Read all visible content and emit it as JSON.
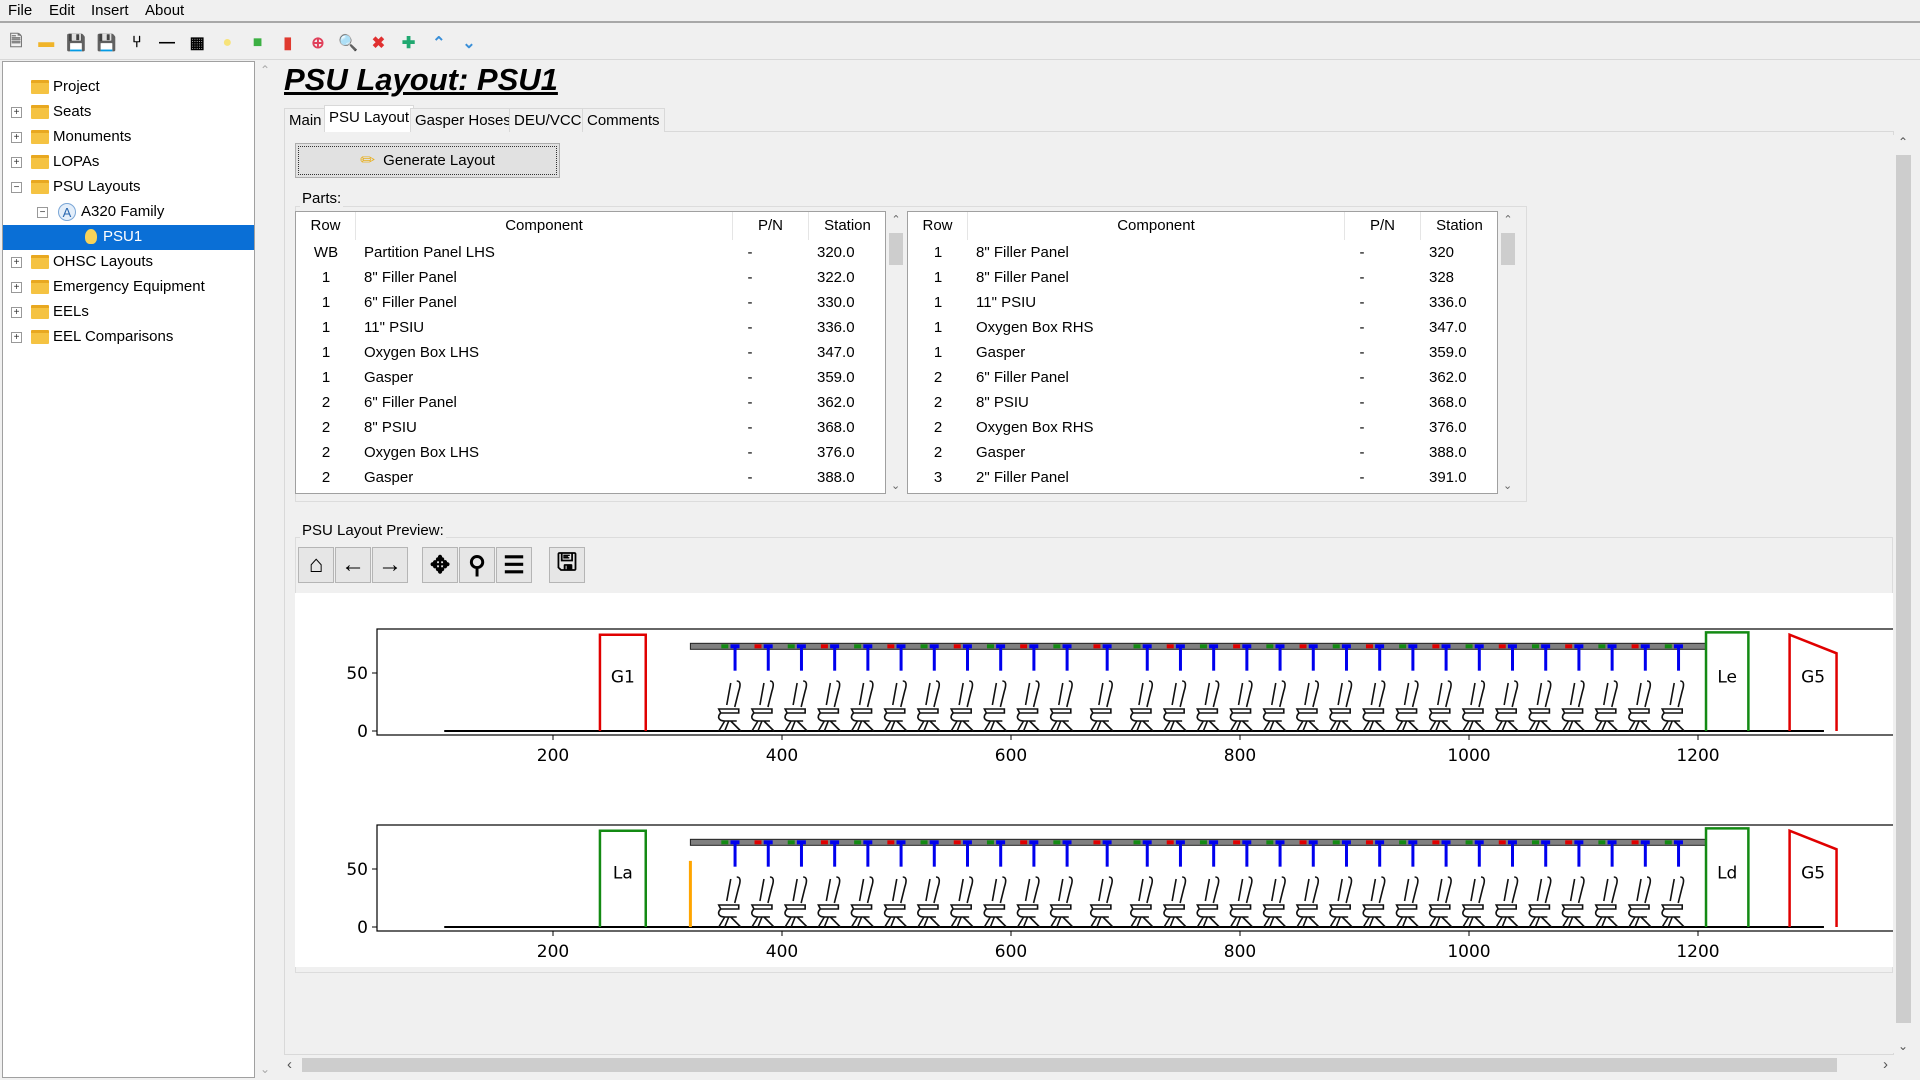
{
  "menu": [
    "File",
    "Edit",
    "Insert",
    "About"
  ],
  "toolbar": [
    "new-file-icon",
    "open-folder-icon",
    "save-icon",
    "save-as-icon",
    "seat-icon",
    "divider-line-icon",
    "seat-row-icon",
    "lightbulb-icon",
    "luggage-icon",
    "fire-extinguisher-icon",
    "add-circle-icon",
    "zoom-icon",
    "delete-icon",
    "add-icon",
    "move-up-icon",
    "move-down-icon"
  ],
  "tree": [
    {
      "label": "Project",
      "level": 0,
      "expander": "",
      "icon": "folder"
    },
    {
      "label": "Seats",
      "level": 0,
      "expander": "+",
      "icon": "folder"
    },
    {
      "label": "Monuments",
      "level": 0,
      "expander": "+",
      "icon": "folder"
    },
    {
      "label": "LOPAs",
      "level": 0,
      "expander": "+",
      "icon": "folder"
    },
    {
      "label": "PSU Layouts",
      "level": 0,
      "expander": "−",
      "icon": "folder"
    },
    {
      "label": "A320 Family",
      "level": 1,
      "expander": "−",
      "icon": "aircraft-family",
      "icon_text": "A"
    },
    {
      "label": "PSU1",
      "level": 2,
      "expander": "",
      "icon": "lightbulb",
      "selected": true
    },
    {
      "label": "OHSC Layouts",
      "level": 0,
      "expander": "+",
      "icon": "folder"
    },
    {
      "label": "Emergency Equipment",
      "level": 0,
      "expander": "+",
      "icon": "folder"
    },
    {
      "label": "EELs",
      "level": 0,
      "expander": "+",
      "icon": "folder"
    },
    {
      "label": "EEL Comparisons",
      "level": 0,
      "expander": "+",
      "icon": "folder"
    }
  ],
  "page_title": "PSU Layout: PSU1",
  "tabs": [
    {
      "label": "Main"
    },
    {
      "label": "PSU Layout",
      "active": true
    },
    {
      "label": "Gasper Hoses"
    },
    {
      "label": "DEU/VCC"
    },
    {
      "label": "Comments"
    }
  ],
  "generate_button": "Generate Layout",
  "parts_label": "Parts:",
  "columns": [
    "Row",
    "Component",
    "P/N",
    "Station"
  ],
  "table_left": [
    [
      "WB",
      "Partition Panel LHS",
      "-",
      "320.0"
    ],
    [
      "1",
      "8\" Filler Panel",
      "-",
      "322.0"
    ],
    [
      "1",
      "6\" Filler Panel",
      "-",
      "330.0"
    ],
    [
      "1",
      "11\" PSIU",
      "-",
      "336.0"
    ],
    [
      "1",
      "Oxygen Box LHS",
      "-",
      "347.0"
    ],
    [
      "1",
      "Gasper",
      "-",
      "359.0"
    ],
    [
      "2",
      "6\" Filler Panel",
      "-",
      "362.0"
    ],
    [
      "2",
      "8\" PSIU",
      "-",
      "368.0"
    ],
    [
      "2",
      "Oxygen Box LHS",
      "-",
      "376.0"
    ],
    [
      "2",
      "Gasper",
      "-",
      "388.0"
    ]
  ],
  "table_right": [
    [
      "1",
      "8\" Filler Panel",
      "-",
      "320"
    ],
    [
      "1",
      "8\" Filler Panel",
      "-",
      "328"
    ],
    [
      "1",
      "11\" PSIU",
      "-",
      "336.0"
    ],
    [
      "1",
      "Oxygen Box RHS",
      "-",
      "347.0"
    ],
    [
      "1",
      "Gasper",
      "-",
      "359.0"
    ],
    [
      "2",
      "6\" Filler Panel",
      "-",
      "362.0"
    ],
    [
      "2",
      "8\" PSIU",
      "-",
      "368.0"
    ],
    [
      "2",
      "Oxygen Box RHS",
      "-",
      "376.0"
    ],
    [
      "2",
      "Gasper",
      "-",
      "388.0"
    ],
    [
      "3",
      "2\" Filler Panel",
      "-",
      "391.0"
    ]
  ],
  "preview_label": "PSU Layout Preview:",
  "nav_toolbar": [
    "home-icon",
    "back-icon",
    "forward-icon",
    "pan-icon",
    "zoom-icon",
    "configure-icon",
    "save-figure-icon"
  ],
  "chart_data": [
    {
      "type": "diagram",
      "x_ticks": [
        200,
        400,
        600,
        800,
        1000,
        1200
      ],
      "y_ticks": [
        0,
        50
      ],
      "xlim": [
        20,
        1420
      ],
      "ylim": [
        -3,
        88
      ],
      "floor": [
        105,
        1310
      ],
      "psu_rail": [
        320,
        1207
      ],
      "monuments": [
        {
          "label": "G1",
          "x": [
            241,
            281
          ],
          "h": 83,
          "color": "#e00000",
          "shape": "rect"
        },
        {
          "label": "Le",
          "x": [
            1207,
            1244
          ],
          "h": 85,
          "color": "#138a13",
          "shape": "rect"
        },
        {
          "label": "G5",
          "x": [
            1280,
            1321
          ],
          "h": [
            83,
            67
          ],
          "color": "#e00000",
          "shape": "trapezoid"
        }
      ],
      "markers": []
    },
    {
      "type": "diagram",
      "x_ticks": [
        200,
        400,
        600,
        800,
        1000,
        1200
      ],
      "y_ticks": [
        0,
        50
      ],
      "xlim": [
        20,
        1420
      ],
      "ylim": [
        -3,
        88
      ],
      "floor": [
        105,
        1310
      ],
      "psu_rail": [
        320,
        1207
      ],
      "monuments": [
        {
          "label": "La",
          "x": [
            241,
            281
          ],
          "h": 83,
          "color": "#138a13",
          "shape": "rect"
        },
        {
          "label": "Ld",
          "x": [
            1207,
            1244
          ],
          "h": 85,
          "color": "#138a13",
          "shape": "rect"
        },
        {
          "label": "G5",
          "x": [
            1280,
            1321
          ],
          "h": [
            83,
            67
          ],
          "color": "#e00000",
          "shape": "trapezoid"
        }
      ],
      "markers": [
        {
          "x": 320,
          "h": 57,
          "color": "#ffa500"
        }
      ]
    }
  ],
  "seat_stations": [
    343,
    372,
    401,
    430,
    459,
    488,
    517,
    546,
    575,
    604,
    633,
    668,
    703,
    732,
    761,
    790,
    819,
    848,
    877,
    906,
    935,
    964,
    993,
    1022,
    1051,
    1080,
    1109,
    1138,
    1167
  ],
  "colors": {
    "selection": "#0a6fd6",
    "gasper": "#0000ee",
    "psiu": "#138a13",
    "oxygen": "#e00000",
    "rail": "#808080"
  }
}
